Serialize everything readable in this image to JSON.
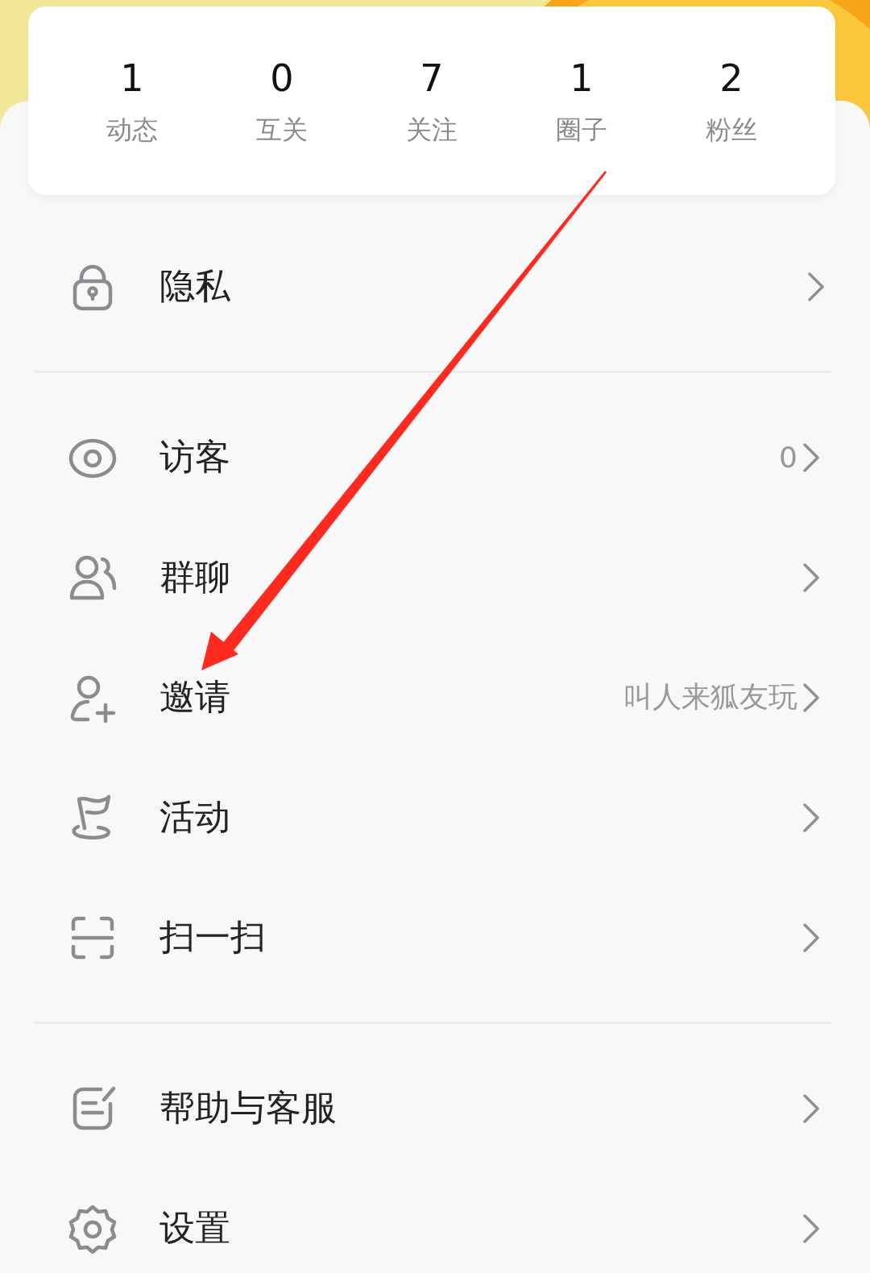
{
  "stats": [
    {
      "count": "1",
      "label": "动态"
    },
    {
      "count": "0",
      "label": "互关"
    },
    {
      "count": "7",
      "label": "关注"
    },
    {
      "count": "1",
      "label": "圈子"
    },
    {
      "count": "2",
      "label": "粉丝"
    }
  ],
  "menu_sections": [
    [
      {
        "label": "隐私"
      }
    ],
    [
      {
        "label": "访客",
        "value": "0"
      },
      {
        "label": "群聊"
      },
      {
        "label": "邀请",
        "value": "叫人来狐友玩"
      },
      {
        "label": "活动"
      },
      {
        "label": "扫一扫"
      }
    ],
    [
      {
        "label": "帮助与客服"
      },
      {
        "label": "设置"
      }
    ]
  ],
  "annotation": {
    "kind": "arrow"
  }
}
